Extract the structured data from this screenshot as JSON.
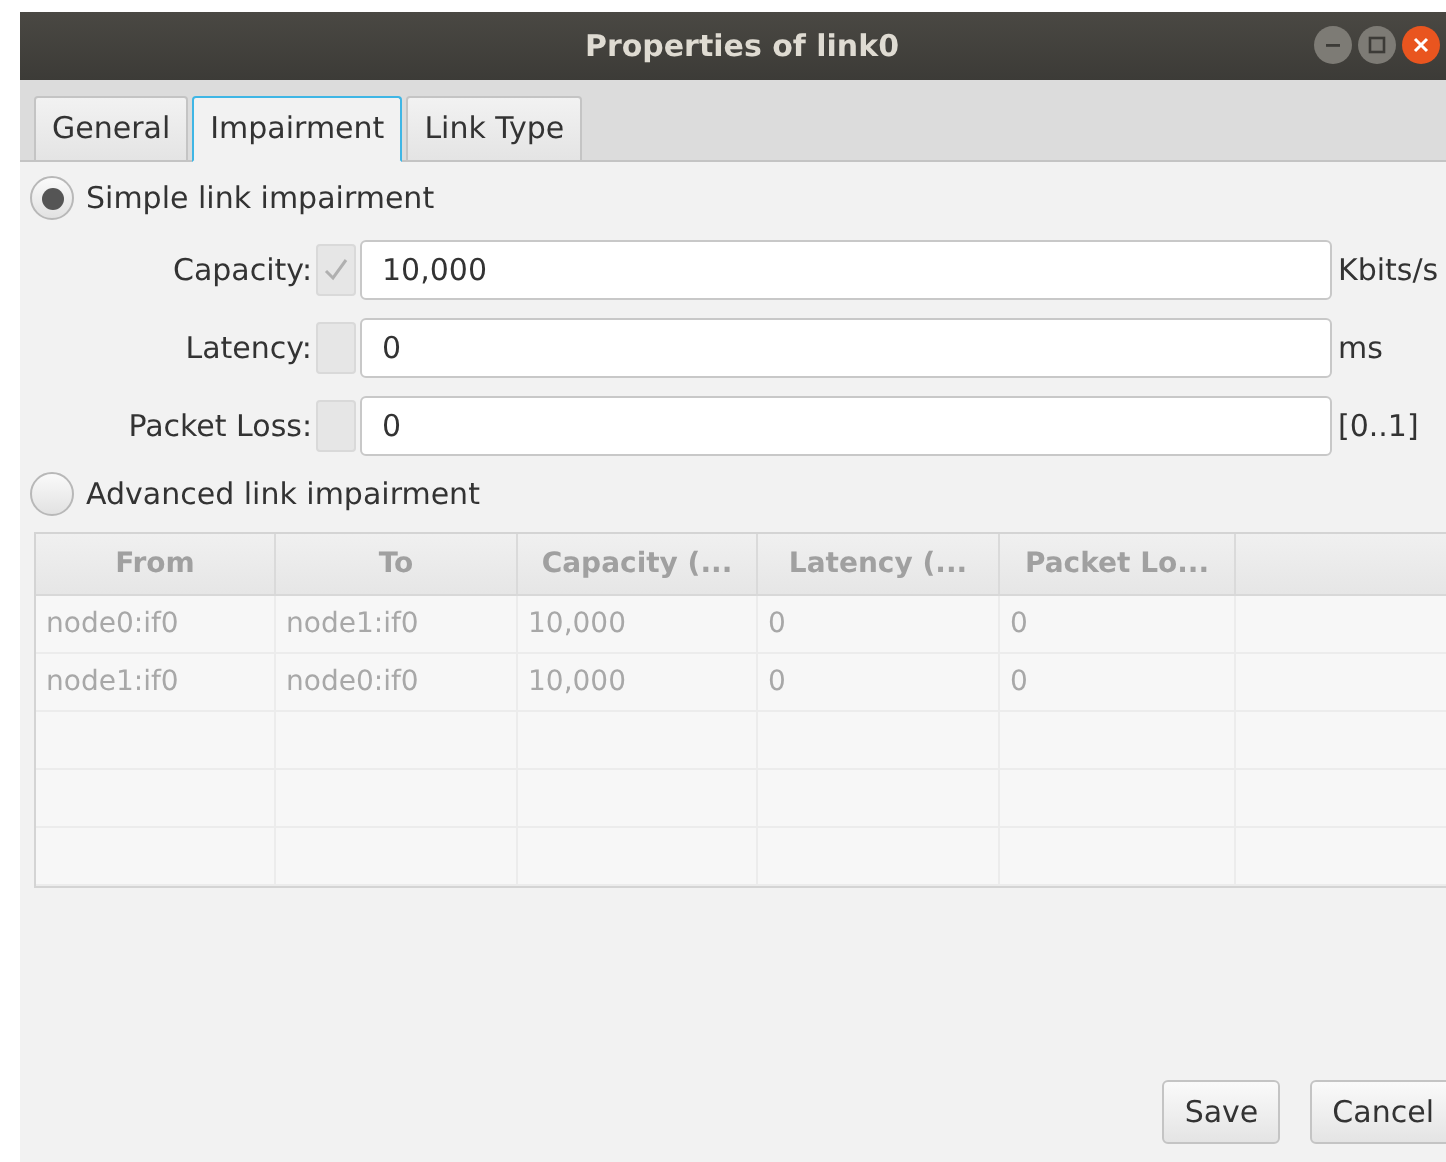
{
  "window": {
    "title": "Properties of link0"
  },
  "tabs": [
    {
      "label": "General",
      "selected": false
    },
    {
      "label": "Impairment",
      "selected": true
    },
    {
      "label": "Link Type",
      "selected": false
    }
  ],
  "modes": [
    {
      "label": "Simple link impairment",
      "selected": true
    },
    {
      "label": "Advanced link impairment",
      "selected": false
    }
  ],
  "fields": [
    {
      "label": "Capacity:",
      "checked": true,
      "value": "10,000",
      "unit": "Kbits/s"
    },
    {
      "label": "Latency:",
      "checked": false,
      "value": "0",
      "unit": "ms"
    },
    {
      "label": "Packet Loss:",
      "checked": false,
      "value": "0",
      "unit": "[0..1]"
    }
  ],
  "table": {
    "disabled": true,
    "columns": [
      "From",
      "To",
      "Capacity (...",
      "Latency (...",
      "Packet Lo..."
    ],
    "rows": [
      [
        "node0:if0",
        "node1:if0",
        "10,000",
        "0",
        "0"
      ],
      [
        "node1:if0",
        "node0:if0",
        "10,000",
        "0",
        "0"
      ]
    ]
  },
  "buttons": [
    "Save",
    "Cancel"
  ]
}
